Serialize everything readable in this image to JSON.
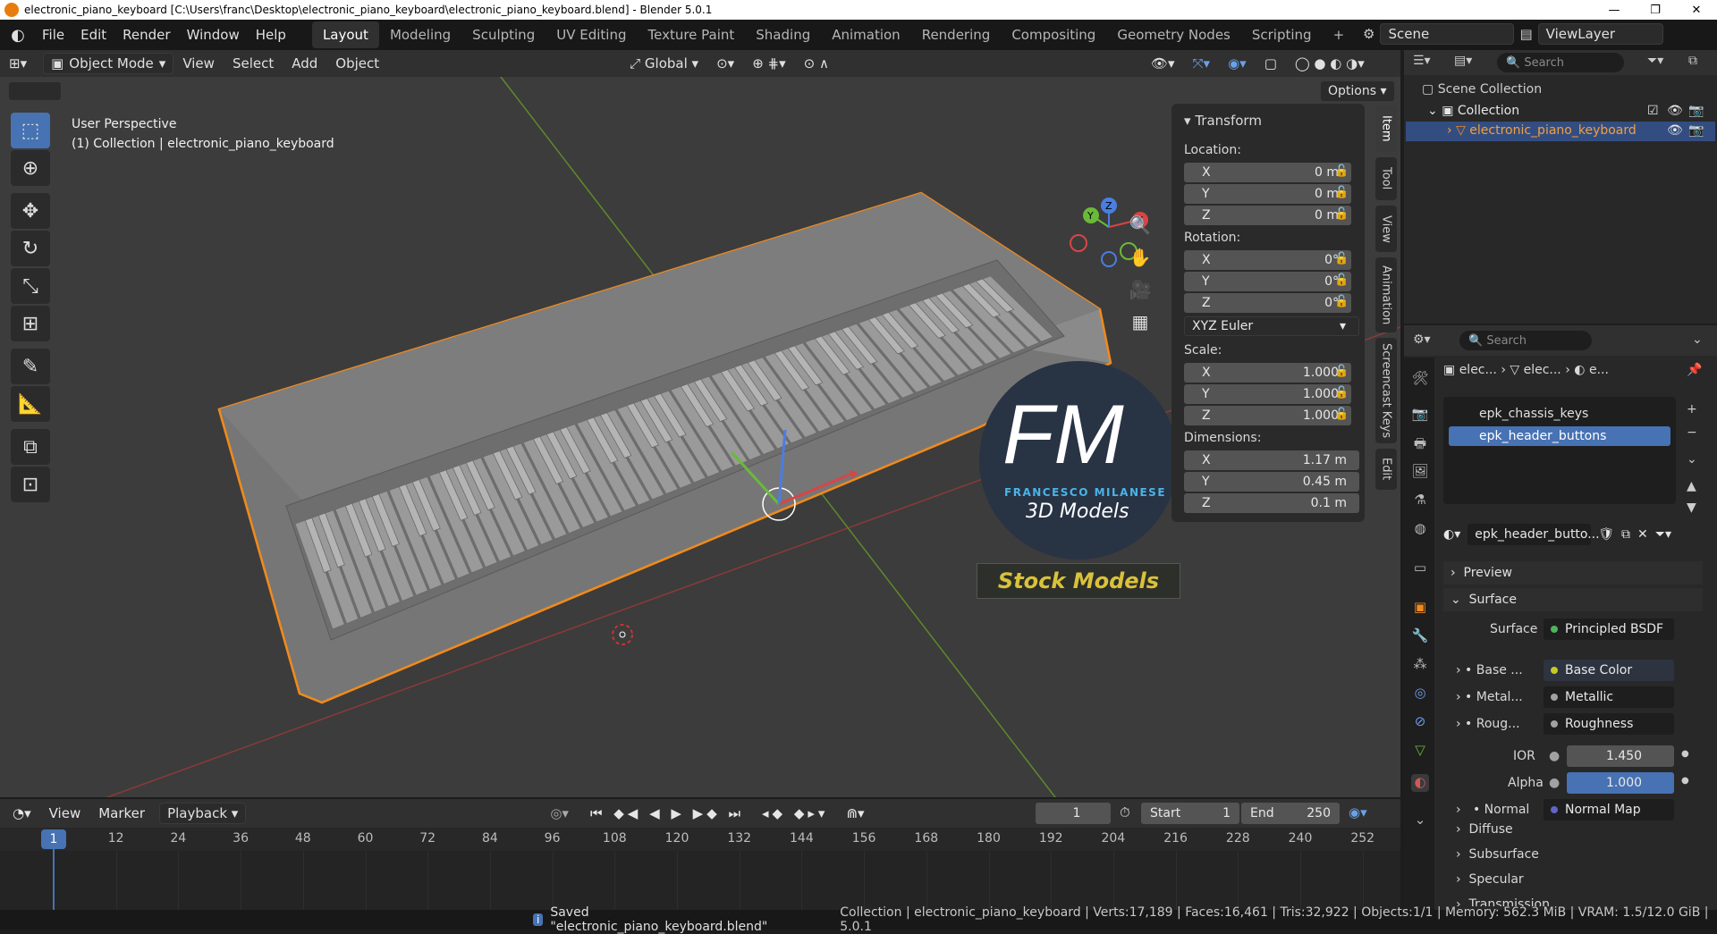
{
  "titlebar": {
    "title": "electronic_piano_keyboard [C:\\Users\\franc\\Desktop\\electronic_piano_keyboard\\electronic_piano_keyboard.blend] - Blender 5.0.1",
    "minimize": "—",
    "maximize": "❐",
    "close": "✕"
  },
  "menu": [
    "File",
    "Edit",
    "Render",
    "Window",
    "Help"
  ],
  "workspaces": [
    "Layout",
    "Modeling",
    "Sculpting",
    "UV Editing",
    "Texture Paint",
    "Shading",
    "Animation",
    "Rendering",
    "Compositing",
    "Geometry Nodes",
    "Scripting"
  ],
  "add_workspace": "+",
  "scene": {
    "label": "Scene",
    "viewlayer": "ViewLayer"
  },
  "viewport_header": {
    "mode": "Object Mode",
    "items": [
      "View",
      "Select",
      "Add",
      "Object"
    ],
    "transform_orientation": "Global"
  },
  "viewport": {
    "perspective": "User Perspective",
    "collection_info": "(1) Collection | electronic_piano_keyboard",
    "options": "Options"
  },
  "logo": {
    "mark": "FM",
    "line1": "FRANCESCO MILANESE",
    "line2": "3D Models",
    "banner": "Stock Models"
  },
  "npanel": {
    "title": "Transform",
    "location_label": "Location:",
    "location": [
      {
        "axis": "X",
        "value": "0 m"
      },
      {
        "axis": "Y",
        "value": "0 m"
      },
      {
        "axis": "Z",
        "value": "0 m"
      }
    ],
    "rotation_label": "Rotation:",
    "rotation": [
      {
        "axis": "X",
        "value": "0°"
      },
      {
        "axis": "Y",
        "value": "0°"
      },
      {
        "axis": "Z",
        "value": "0°"
      }
    ],
    "rotation_mode": "XYZ Euler",
    "scale_label": "Scale:",
    "scale": [
      {
        "axis": "X",
        "value": "1.000"
      },
      {
        "axis": "Y",
        "value": "1.000"
      },
      {
        "axis": "Z",
        "value": "1.000"
      }
    ],
    "dimensions_label": "Dimensions:",
    "dimensions": [
      {
        "axis": "X",
        "value": "1.17 m"
      },
      {
        "axis": "Y",
        "value": "0.45 m"
      },
      {
        "axis": "Z",
        "value": "0.1 m"
      }
    ]
  },
  "side_tabs": [
    "Item",
    "Tool",
    "View",
    "Animation",
    "Screencast Keys",
    "Edit"
  ],
  "outliner": {
    "search_placeholder": "Search",
    "scene_collection": "Scene Collection",
    "collection": "Collection",
    "object": "electronic_piano_keyboard"
  },
  "properties": {
    "search_placeholder": "Search",
    "breadcrumb": [
      "elec...",
      "elec...",
      "e..."
    ],
    "materials": [
      "epk_chassis_keys",
      "epk_header_buttons"
    ],
    "material_name": "epk_header_butto...",
    "preview": "Preview",
    "surface_section": "Surface",
    "surface_label": "Surface",
    "surface_value": "Principled BSDF",
    "rows": [
      {
        "label": "Base ...",
        "value": "Base Color",
        "dot": "#c7c729"
      },
      {
        "label": "Metal...",
        "value": "Metallic",
        "dot": "#a1a1a1"
      },
      {
        "label": "Roug...",
        "value": "Roughness",
        "dot": "#a1a1a1"
      }
    ],
    "ior_label": "IOR",
    "ior_value": "1.450",
    "alpha_label": "Alpha",
    "alpha_value": "1.000",
    "normal_label": "Normal",
    "normal_value": "Normal Map",
    "subsections": [
      "Diffuse",
      "Subsurface",
      "Specular",
      "Transmission"
    ]
  },
  "timeline": {
    "menus": [
      "View",
      "Marker"
    ],
    "playback": "Playback",
    "current_frame": "1",
    "start_label": "Start",
    "start_value": "1",
    "end_label": "End",
    "end_value": "250",
    "ticks": [
      "1",
      "12",
      "24",
      "36",
      "48",
      "60",
      "72",
      "84",
      "96",
      "108",
      "120",
      "132",
      "144",
      "156",
      "168",
      "180",
      "192",
      "204",
      "216",
      "228",
      "240",
      "252"
    ]
  },
  "status": {
    "message": "Saved \"electronic_piano_keyboard.blend\"",
    "stats": "Collection | electronic_piano_keyboard | Verts:17,189 | Faces:16,461 | Tris:32,922 | Objects:1/1 | Memory: 562.3 MiB | VRAM: 1.5/12.0 GiB | 5.0.1"
  }
}
